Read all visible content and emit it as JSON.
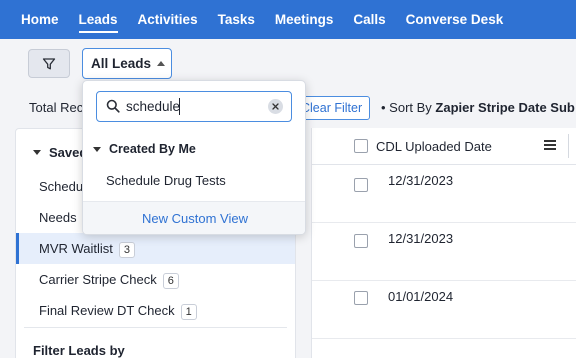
{
  "nav": {
    "items": [
      {
        "label": "Home",
        "active": false
      },
      {
        "label": "Leads",
        "active": true
      },
      {
        "label": "Activities",
        "active": false
      },
      {
        "label": "Tasks",
        "active": false
      },
      {
        "label": "Meetings",
        "active": false
      },
      {
        "label": "Calls",
        "active": false
      },
      {
        "label": "Converse Desk",
        "active": false
      }
    ]
  },
  "toolbar": {
    "filter_icon": "funnel-icon",
    "view_label": "All Leads"
  },
  "infobar": {
    "total_records_label": "Total Rec",
    "clear_filter_label": "Clear Filter",
    "sort_prefix": "Sort By",
    "sort_field": "Zapier Stripe Date Sub"
  },
  "left_panel": {
    "saved_header": "Saved",
    "items": [
      {
        "label": "Schedule",
        "badge": ""
      },
      {
        "label": "Needs",
        "badge": ""
      },
      {
        "label": "MVR Waitlist",
        "badge": "3"
      },
      {
        "label": "Carrier Stripe Check",
        "badge": "6"
      },
      {
        "label": "Final Review DT Check",
        "badge": "1"
      }
    ],
    "filter_header": "Filter Leads by"
  },
  "table": {
    "column_header": "CDL Uploaded Date",
    "rows": [
      {
        "cdl_uploaded_date": "12/31/2023"
      },
      {
        "cdl_uploaded_date": "12/31/2023"
      },
      {
        "cdl_uploaded_date": "01/01/2024"
      }
    ]
  },
  "dropdown": {
    "search_value": "schedule",
    "group_header": "Created By Me",
    "items": [
      "Schedule Drug Tests"
    ],
    "footer_action": "New Custom View"
  },
  "colors": {
    "nav_bg": "#2f72d3",
    "accent": "#4b8de0",
    "active_row_bg": "#e6eefb"
  }
}
